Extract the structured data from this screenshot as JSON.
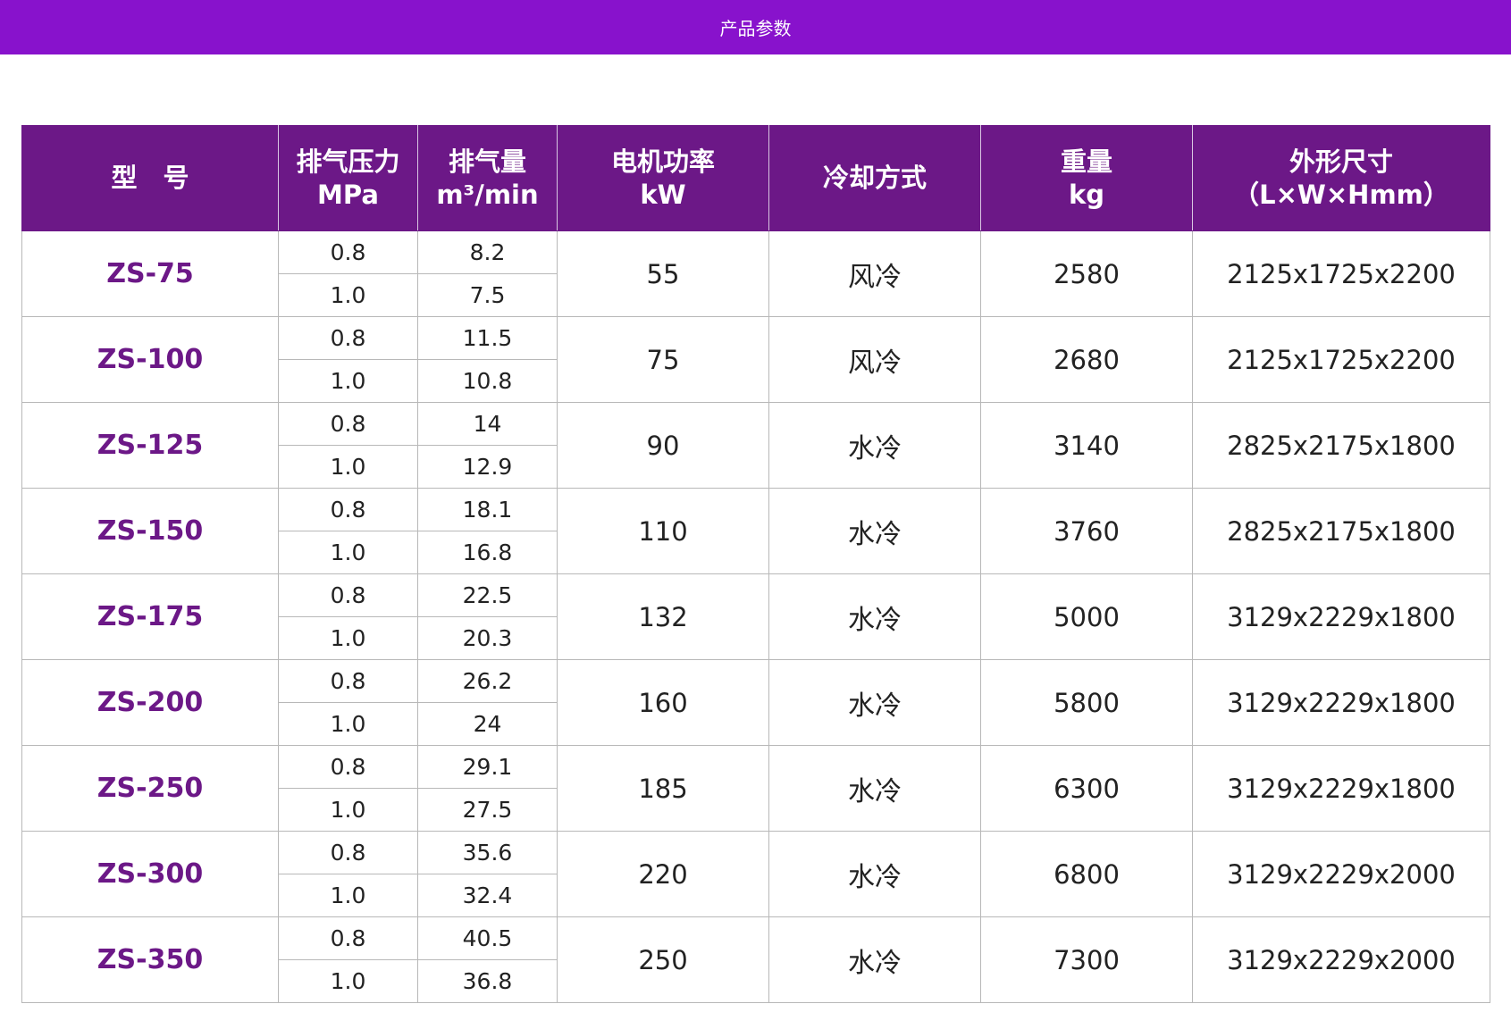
{
  "page": {
    "banner_title": "产品参数"
  },
  "table": {
    "headers": [
      {
        "line1": "型　号",
        "line2": ""
      },
      {
        "line1": "排气压力",
        "line2": "MPa"
      },
      {
        "line1": "排气量",
        "line2": "m³/min"
      },
      {
        "line1": "电机功率",
        "line2": "kW"
      },
      {
        "line1": "冷却方式",
        "line2": ""
      },
      {
        "line1": "重量",
        "line2": "kg"
      },
      {
        "line1": "外形尺寸",
        "line2": "（L×W×Hmm）"
      }
    ],
    "rows": [
      {
        "model": "ZS-75",
        "pressure": [
          "0.8",
          "1.0"
        ],
        "flow": [
          "8.2",
          "7.5"
        ],
        "power": "55",
        "cooling": "风冷",
        "weight": "2580",
        "dims": "2125x1725x2200"
      },
      {
        "model": "ZS-100",
        "pressure": [
          "0.8",
          "1.0"
        ],
        "flow": [
          "11.5",
          "10.8"
        ],
        "power": "75",
        "cooling": "风冷",
        "weight": "2680",
        "dims": "2125x1725x2200"
      },
      {
        "model": "ZS-125",
        "pressure": [
          "0.8",
          "1.0"
        ],
        "flow": [
          "14",
          "12.9"
        ],
        "power": "90",
        "cooling": "水冷",
        "weight": "3140",
        "dims": "2825x2175x1800"
      },
      {
        "model": "ZS-150",
        "pressure": [
          "0.8",
          "1.0"
        ],
        "flow": [
          "18.1",
          "16.8"
        ],
        "power": "110",
        "cooling": "水冷",
        "weight": "3760",
        "dims": "2825x2175x1800"
      },
      {
        "model": "ZS-175",
        "pressure": [
          "0.8",
          "1.0"
        ],
        "flow": [
          "22.5",
          "20.3"
        ],
        "power": "132",
        "cooling": "水冷",
        "weight": "5000",
        "dims": "3129x2229x1800"
      },
      {
        "model": "ZS-200",
        "pressure": [
          "0.8",
          "1.0"
        ],
        "flow": [
          "26.2",
          "24"
        ],
        "power": "160",
        "cooling": "水冷",
        "weight": "5800",
        "dims": "3129x2229x1800"
      },
      {
        "model": "ZS-250",
        "pressure": [
          "0.8",
          "1.0"
        ],
        "flow": [
          "29.1",
          "27.5"
        ],
        "power": "185",
        "cooling": "水冷",
        "weight": "6300",
        "dims": "3129x2229x1800"
      },
      {
        "model": "ZS-300",
        "pressure": [
          "0.8",
          "1.0"
        ],
        "flow": [
          "35.6",
          "32.4"
        ],
        "power": "220",
        "cooling": "水冷",
        "weight": "6800",
        "dims": "3129x2229x2000"
      },
      {
        "model": "ZS-350",
        "pressure": [
          "0.8",
          "1.0"
        ],
        "flow": [
          "40.5",
          "36.8"
        ],
        "power": "250",
        "cooling": "水冷",
        "weight": "7300",
        "dims": "3129x2229x2000"
      }
    ]
  },
  "colors": {
    "banner": "#8812cc",
    "header": "#6c1887",
    "model_text": "#6c1887",
    "grid": "#b8b8b8"
  }
}
